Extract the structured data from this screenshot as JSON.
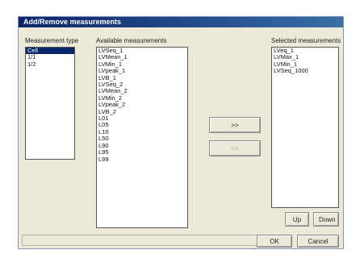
{
  "dialog": {
    "title": "Add/Remove measurements"
  },
  "measurement_type": {
    "label": "Measurement type",
    "items": [
      {
        "label": "Cell",
        "selected": true
      },
      {
        "label": "1/1",
        "selected": false
      },
      {
        "label": "1/2",
        "selected": false
      }
    ]
  },
  "available": {
    "label": "Available measurements",
    "items": [
      {
        "label": "LVSeq_1",
        "selected": false
      },
      {
        "label": "LVMean_1",
        "selected": false
      },
      {
        "label": "LVMin_1",
        "selected": false
      },
      {
        "label": "LVpeak_1",
        "selected": false
      },
      {
        "label": "LVB_1",
        "selected": false
      },
      {
        "label": "LVSeq_2",
        "selected": false
      },
      {
        "label": "LVMean_2",
        "selected": false
      },
      {
        "label": "LVMin_2",
        "selected": false
      },
      {
        "label": "LVpeak_2",
        "selected": false
      },
      {
        "label": "LVB_2",
        "selected": false
      },
      {
        "label": "L01",
        "selected": false
      },
      {
        "label": "L05",
        "selected": false
      },
      {
        "label": "L10",
        "selected": false
      },
      {
        "label": "L50",
        "selected": false
      },
      {
        "label": "L90",
        "selected": false
      },
      {
        "label": "L95",
        "selected": false
      },
      {
        "label": "L99",
        "selected": false
      }
    ]
  },
  "selected": {
    "label": "Selected measurements",
    "items": [
      {
        "label": "LVeq_1",
        "selected": false
      },
      {
        "label": "LVMax_1",
        "selected": false
      },
      {
        "label": "LVMin_1",
        "selected": false
      },
      {
        "label": "LVSeq_1000",
        "selected": false
      }
    ]
  },
  "buttons": {
    "add": ">>",
    "remove": "<<",
    "up": "Up",
    "down": "Down",
    "ok": "OK",
    "cancel": "Cancel"
  }
}
